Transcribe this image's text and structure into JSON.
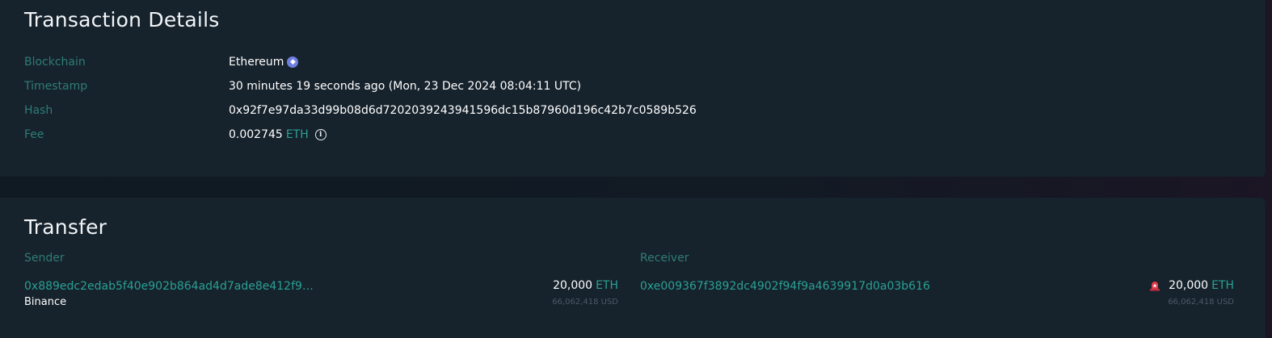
{
  "details": {
    "title": "Transaction Details",
    "rows": {
      "blockchain": {
        "label": "Blockchain",
        "value": "Ethereum",
        "icon": "ethereum-icon"
      },
      "timestamp": {
        "label": "Timestamp",
        "value": "30 minutes 19 seconds ago (Mon, 23 Dec 2024 08:04:11 UTC)"
      },
      "hash": {
        "label": "Hash",
        "value": "0x92f7e97da33d99b08d6d7202039243941596dc15b87960d196c42b7c0589b526"
      },
      "fee": {
        "label": "Fee",
        "amount": "0.002745",
        "unit": "ETH",
        "icon": "info-icon"
      }
    }
  },
  "transfer": {
    "title": "Transfer",
    "sender": {
      "header": "Sender",
      "address": "0x889edc2edab5f40e902b864ad4d7ade8e412f9…",
      "entity": "Binance",
      "amount": "20,000",
      "unit": "ETH",
      "usd": "66,062,418 USD"
    },
    "receiver": {
      "header": "Receiver",
      "address": "0xe009367f3892dc4902f94f9a4639917d0a03b616",
      "amount": "20,000",
      "unit": "ETH",
      "usd": "66,062,418 USD",
      "icon": "alert-siren-icon"
    }
  },
  "colors": {
    "background": "#16222c",
    "label": "#2e7d76",
    "link": "#2aa194",
    "ethereum_badge": "#6f7fe0",
    "alert": "#e0394a"
  }
}
